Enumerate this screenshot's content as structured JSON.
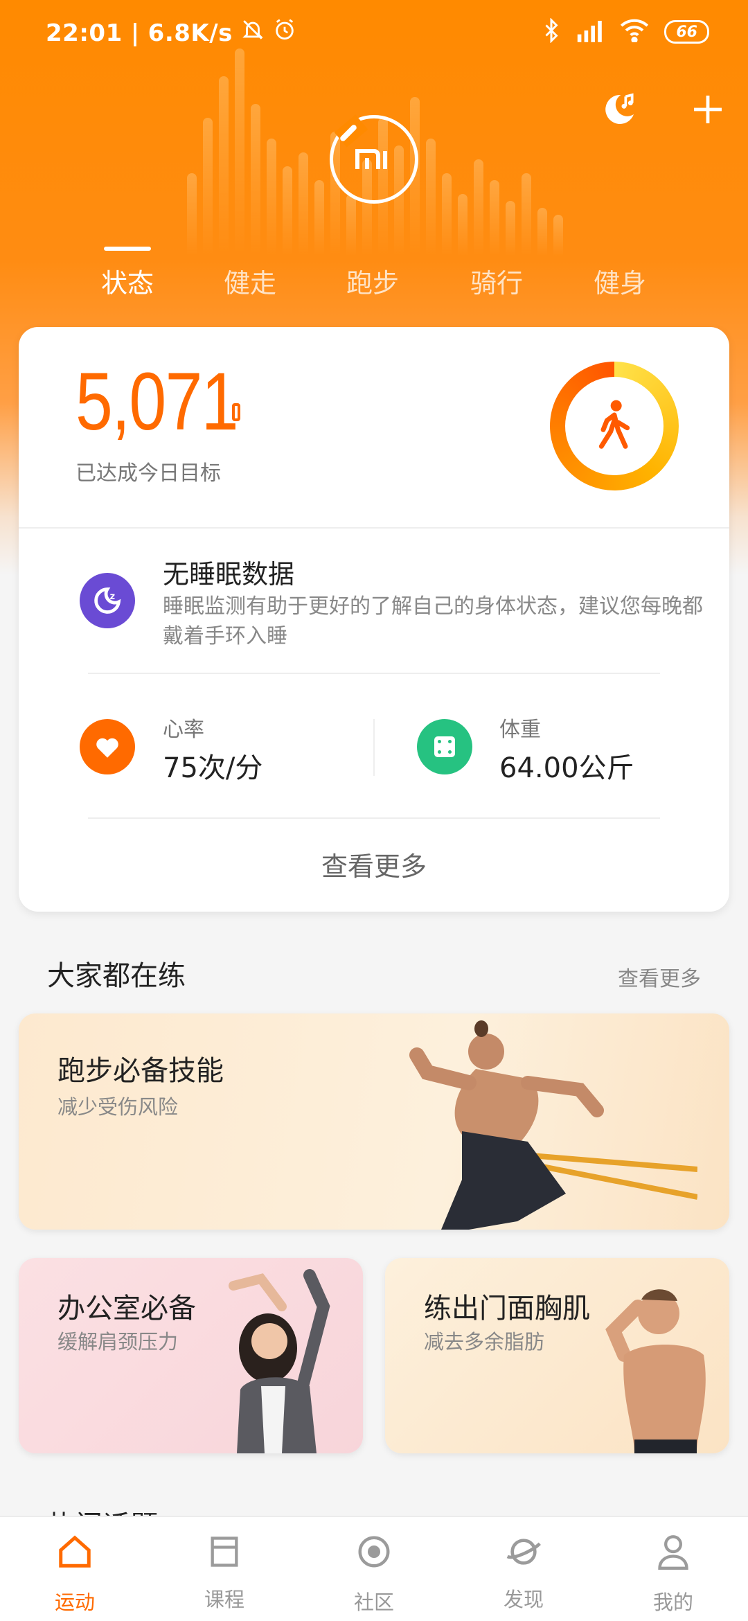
{
  "status_bar": {
    "time": "22:01",
    "speed": "6.8K/s",
    "battery": "66"
  },
  "header": {
    "tabs": [
      {
        "label": "状态",
        "active": true
      },
      {
        "label": "健走",
        "active": false
      },
      {
        "label": "跑步",
        "active": false
      },
      {
        "label": "骑行",
        "active": false
      },
      {
        "label": "健身",
        "active": false
      }
    ]
  },
  "summary": {
    "steps": "5,071",
    "goal_text": "已达成今日目标",
    "sleep_title": "无睡眠数据",
    "sleep_desc": "睡眠监测有助于更好的了解自己的身体状态，建议您每晚都戴着手环入睡",
    "heart_label": "心率",
    "heart_value": "75次/分",
    "weight_label": "体重",
    "weight_value": "64.00公斤",
    "see_more": "查看更多"
  },
  "section": {
    "title": "大家都在练",
    "more": "查看更多"
  },
  "courses": [
    {
      "title": "跑步必备技能",
      "subtitle": "减少受伤风险"
    },
    {
      "title": "办公室必备",
      "subtitle": "缓解肩颈压力"
    },
    {
      "title": "练出门面胸肌",
      "subtitle": "减去多余脂肪"
    }
  ],
  "next_section_title": "热门话题",
  "tabbar": [
    {
      "label": "运动",
      "active": true,
      "icon": "home-icon"
    },
    {
      "label": "课程",
      "active": false,
      "icon": "course-icon"
    },
    {
      "label": "社区",
      "active": false,
      "icon": "community-icon"
    },
    {
      "label": "发现",
      "active": false,
      "icon": "discover-icon"
    },
    {
      "label": "我的",
      "active": false,
      "icon": "profile-icon"
    }
  ],
  "colors": {
    "accent": "#ff6a00",
    "sleep": "#6a4bd4",
    "heart": "#ff6a00",
    "weight": "#26c281"
  }
}
